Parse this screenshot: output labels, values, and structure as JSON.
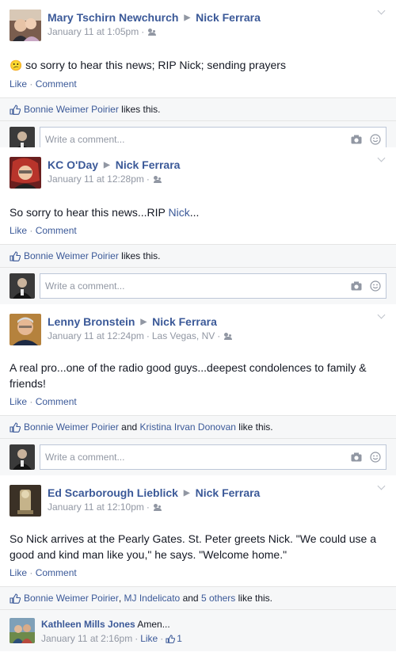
{
  "posts": [
    {
      "author": "Mary Tschirn Newchurch",
      "target": "Nick Ferrara",
      "time": "January 11 at 1:05pm",
      "location": "",
      "body": "so sorry to hear this news; RIP Nick; sending prayers",
      "emoticon": "😕",
      "like_label": "Like",
      "comment_label": "Comment",
      "likers": "Bonnie Weimer Poirier",
      "likes_suffix": "likes this.",
      "comment_placeholder": "Write a comment..."
    },
    {
      "author": "KC O'Day",
      "target": "Nick Ferrara",
      "time": "January 11 at 12:28pm",
      "location": "",
      "body_pre": "So sorry to hear this news...RIP ",
      "body_link": "Nick",
      "body_post": "...",
      "like_label": "Like",
      "comment_label": "Comment",
      "likers": "Bonnie Weimer Poirier",
      "likes_suffix": "likes this.",
      "comment_placeholder": "Write a comment..."
    },
    {
      "author": "Lenny Bronstein",
      "target": "Nick Ferrara",
      "time": "January 11 at 12:24pm",
      "location": "Las Vegas, NV",
      "body": "A real pro...one of the radio good guys...deepest condolences to family & friends!",
      "like_label": "Like",
      "comment_label": "Comment",
      "likers": "Bonnie Weimer Poirier",
      "likers_and": "and",
      "likers_2": "Kristina Irvan Donovan",
      "likes_suffix": "like this.",
      "comment_placeholder": "Write a comment..."
    },
    {
      "author": "Ed Scarborough Lieblick",
      "target": "Nick Ferrara",
      "time": "January 11 at 12:10pm",
      "location": "",
      "body": "So Nick arrives at the Pearly Gates. St. Peter greets Nick. \"We could use a good and kind man like you,\" he says. \"Welcome home.\"",
      "like_label": "Like",
      "comment_label": "Comment",
      "likers": "Bonnie Weimer Poirier",
      "likers_comma": ",",
      "likers_2": "MJ Indelicato",
      "likers_and": "and",
      "likers_3": "5 others",
      "likes_suffix": "like this.",
      "reply": {
        "author": "Kathleen Mills Jones",
        "text": "Amen...",
        "time": "January 11 at 2:16pm",
        "like_label": "Like",
        "like_count": "1"
      }
    }
  ],
  "separator": "·",
  "icons": {
    "audience": "friends-icon",
    "thumb": "thumbs-up-icon",
    "camera": "camera-icon",
    "smiley": "smiley-icon",
    "chevron": "chevron-down-icon"
  },
  "colors": {
    "link": "#3b5998",
    "muted": "#9197a3",
    "background": "#e9eaed"
  }
}
